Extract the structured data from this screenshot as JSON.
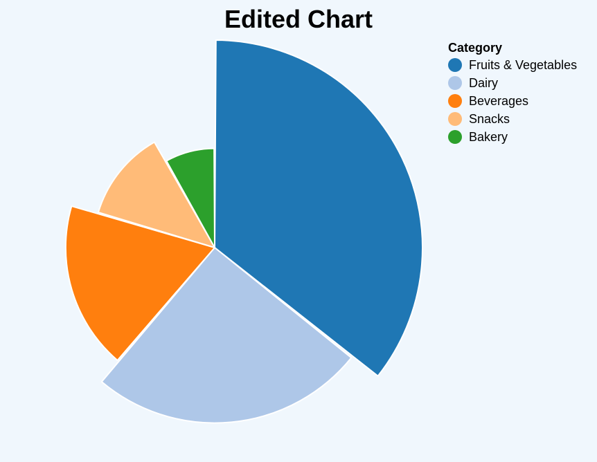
{
  "title": "Edited Chart",
  "legend": {
    "title": "Category"
  },
  "chart_data": {
    "type": "pie",
    "title": "Edited Chart",
    "legend_title": "Category",
    "legend_position": "top-right",
    "categories": [
      "Fruits & Vegetables",
      "Dairy",
      "Beverages",
      "Snacks",
      "Bakery"
    ],
    "values": [
      35,
      25,
      18,
      12,
      8
    ],
    "colors": [
      "#1f77b4",
      "#aec7e8",
      "#ff7f0e",
      "#ffbb78",
      "#2ca02c"
    ]
  }
}
